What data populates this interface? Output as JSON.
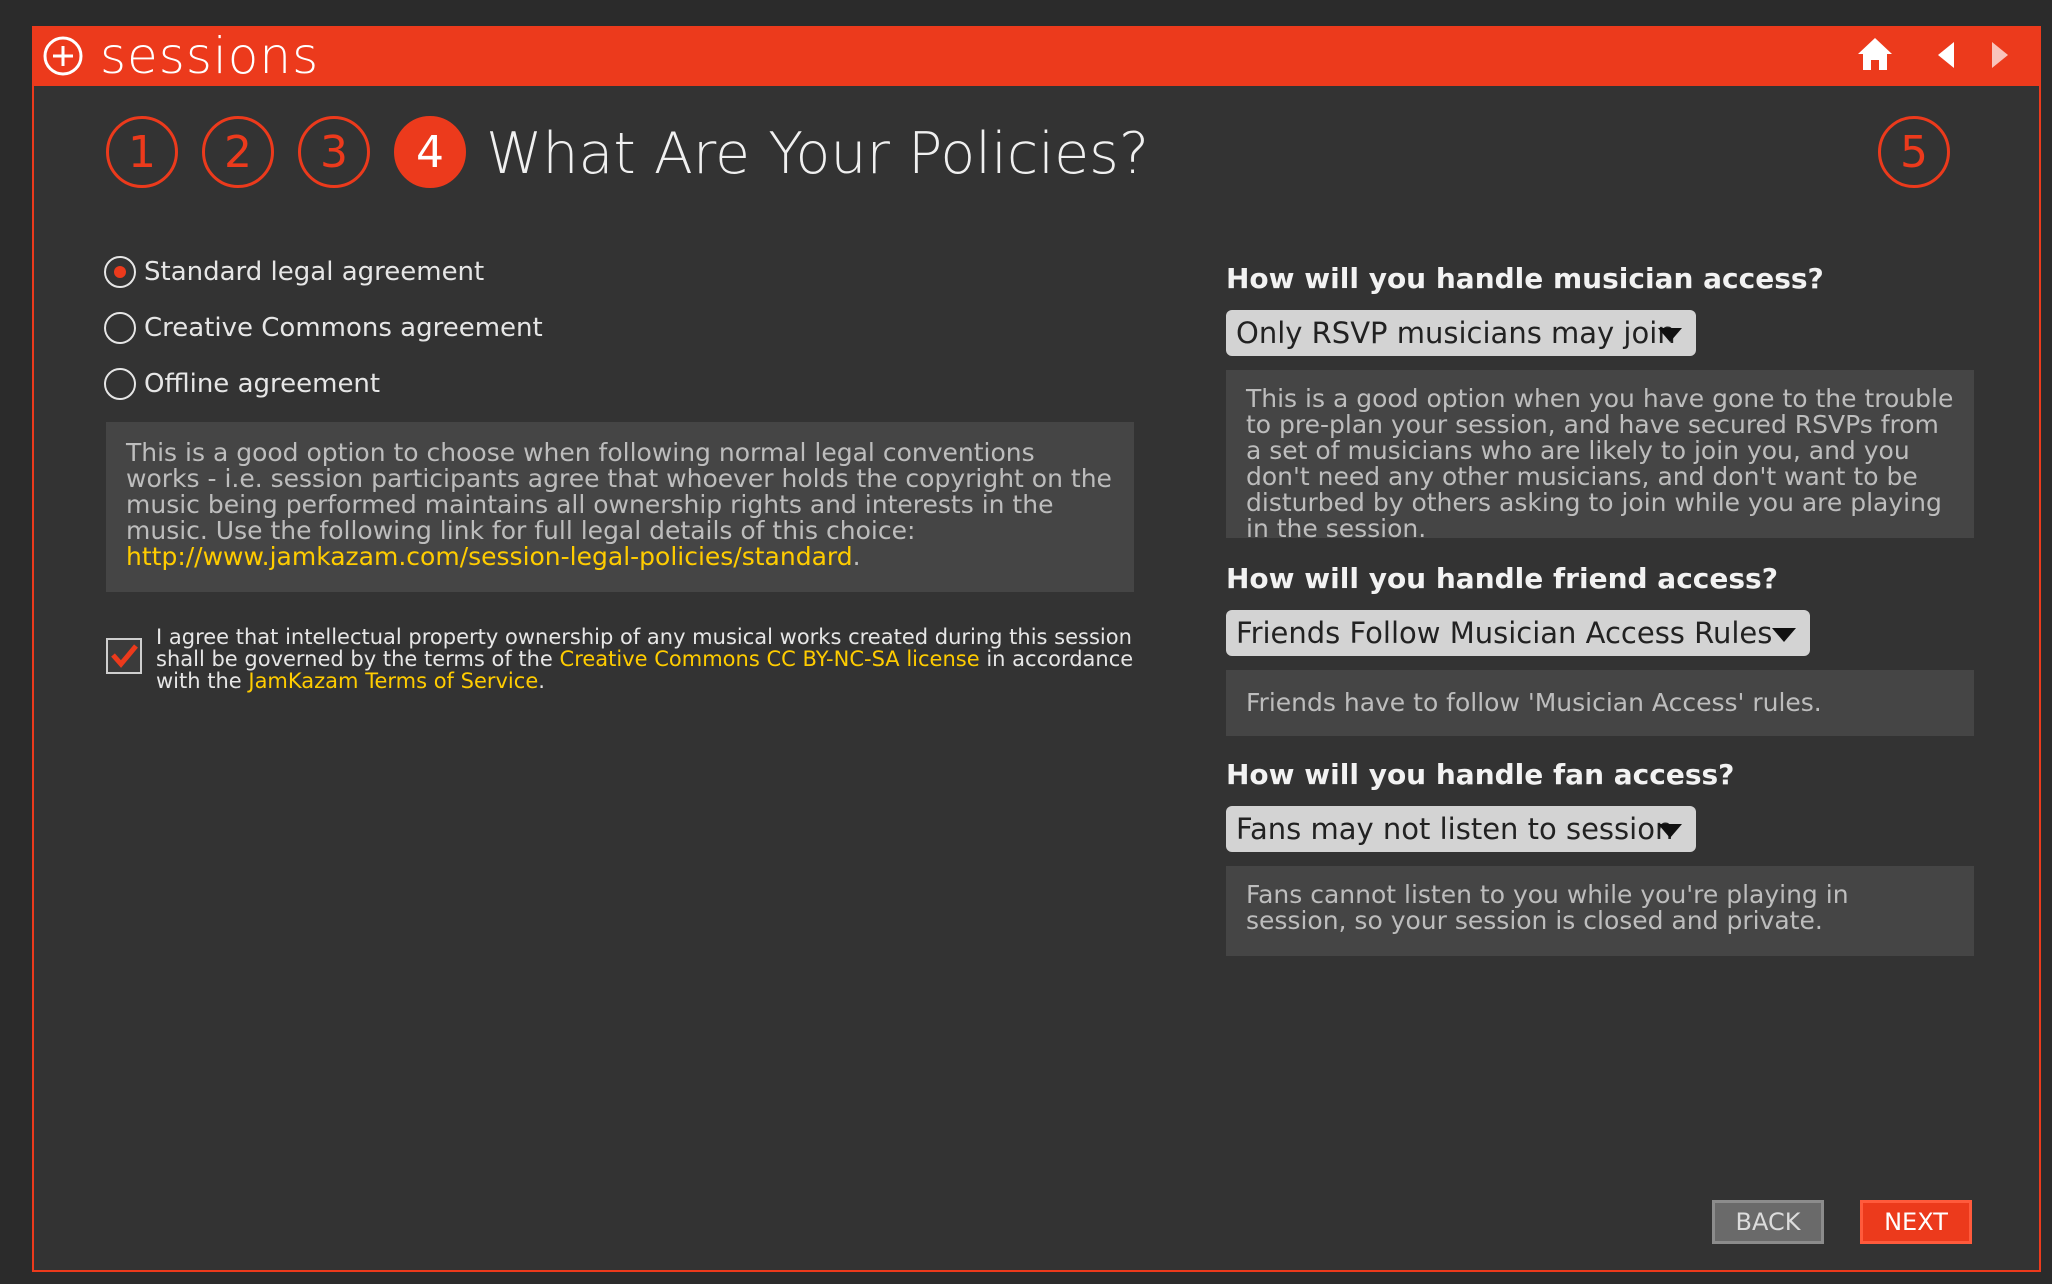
{
  "window": {
    "title": "sessions",
    "accent": "#ec3a1c"
  },
  "nav": {
    "home_icon": "home-icon",
    "prev_icon": "arrow-left-icon",
    "next_icon": "arrow-right-icon"
  },
  "steps": [
    "1",
    "2",
    "3",
    "4",
    "5"
  ],
  "active_step": "4",
  "page_title": "What Are Your Policies?",
  "agreements": {
    "options": [
      "Standard legal agreement",
      "Creative Commons agreement",
      "Offline agreement"
    ],
    "selected": "Standard legal agreement",
    "description": "This is a good option to choose when following normal legal conventions works - i.e. session participants agree that whoever holds the copyright on the music being performed maintains all ownership rights and interests in the music. Use the following link for full legal details of this choice:",
    "link": "http://www.jamkazam.com/session-legal-policies/standard",
    "link_suffix": "."
  },
  "agree": {
    "checked": true,
    "text_1": "I agree that intellectual property ownership of any musical works created during this session shall be governed by the terms of the ",
    "link_1": "Creative Commons CC BY-NC-SA license",
    "text_2": " in accordance with the ",
    "link_2": "JamKazam Terms of Service",
    "text_3": "."
  },
  "musician_access": {
    "question": "How will you handle musician access?",
    "selected": "Only RSVP musicians may join",
    "description": "This is a good option when you have gone to the trouble to pre-plan your session, and have secured RSVPs from a set of musicians who are likely to join you, and you don't need any other musicians, and don't want to be disturbed by others asking to join while you are playing in the session."
  },
  "friend_access": {
    "question": "How will you handle friend access?",
    "selected": "Friends Follow Musician Access Rules",
    "description": "Friends have to follow 'Musician Access' rules."
  },
  "fan_access": {
    "question": "How will you handle fan access?",
    "selected": "Fans may not listen to session",
    "description": "Fans cannot listen to you while you're playing in session, so your session is closed and private."
  },
  "buttons": {
    "back": "BACK",
    "next": "NEXT"
  }
}
